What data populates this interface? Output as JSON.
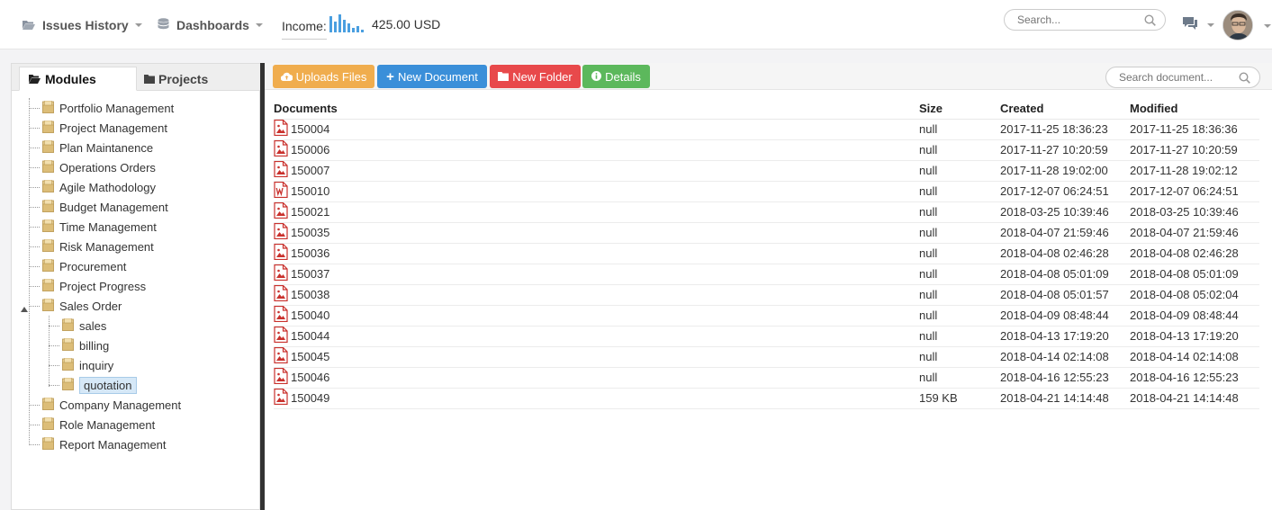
{
  "header": {
    "issues_history": "Issues History",
    "dashboards": "Dashboards",
    "income_label": "Income:",
    "income_value": "425.00 USD",
    "search_placeholder": "Search..."
  },
  "left_panel": {
    "tabs": [
      {
        "label": "Modules",
        "active": true
      },
      {
        "label": "Projects",
        "active": false
      }
    ],
    "tree": [
      {
        "label": "Portfolio Management",
        "level": 0
      },
      {
        "label": "Project Management",
        "level": 0
      },
      {
        "label": "Plan Maintanence",
        "level": 0
      },
      {
        "label": "Operations Orders",
        "level": 0
      },
      {
        "label": "Agile Mathodology",
        "level": 0
      },
      {
        "label": "Budget Management",
        "level": 0
      },
      {
        "label": "Time Management",
        "level": 0
      },
      {
        "label": "Risk Management",
        "level": 0
      },
      {
        "label": "Procurement",
        "level": 0
      },
      {
        "label": "Project Progress",
        "level": 0
      },
      {
        "label": "Sales Order",
        "level": 0,
        "expanded": true
      },
      {
        "label": "sales",
        "level": 1
      },
      {
        "label": "billing",
        "level": 1
      },
      {
        "label": "inquiry",
        "level": 1
      },
      {
        "label": "quotation",
        "level": 1,
        "selected": true
      },
      {
        "label": "Company Management",
        "level": 0
      },
      {
        "label": "Role Management",
        "level": 0
      },
      {
        "label": "Report Management",
        "level": 0
      }
    ]
  },
  "toolbar": {
    "upload": "Uploads Files",
    "new_document": "New Document",
    "new_folder": "New Folder",
    "details": "Details",
    "search_placeholder": "Search document..."
  },
  "colors": {
    "upload": "#f0ad4e",
    "new_document": "#3a8fd9",
    "new_folder": "#e8494b",
    "details": "#5cb85c",
    "file_icon": "#c9302c"
  },
  "table": {
    "headers": [
      "Documents",
      "Size",
      "Created",
      "Modified"
    ],
    "rows": [
      {
        "name": "150004",
        "type": "image",
        "size": "null",
        "created": "2017-11-25 18:36:23",
        "modified": "2017-11-25 18:36:36"
      },
      {
        "name": "150006",
        "type": "image",
        "size": "null",
        "created": "2017-11-27 10:20:59",
        "modified": "2017-11-27 10:20:59"
      },
      {
        "name": "150007",
        "type": "image",
        "size": "null",
        "created": "2017-11-28 19:02:00",
        "modified": "2017-11-28 19:02:12"
      },
      {
        "name": "150010",
        "type": "word",
        "size": "null",
        "created": "2017-12-07 06:24:51",
        "modified": "2017-12-07 06:24:51"
      },
      {
        "name": "150021",
        "type": "image",
        "size": "null",
        "created": "2018-03-25 10:39:46",
        "modified": "2018-03-25 10:39:46"
      },
      {
        "name": "150035",
        "type": "image",
        "size": "null",
        "created": "2018-04-07 21:59:46",
        "modified": "2018-04-07 21:59:46"
      },
      {
        "name": "150036",
        "type": "image",
        "size": "null",
        "created": "2018-04-08 02:46:28",
        "modified": "2018-04-08 02:46:28"
      },
      {
        "name": "150037",
        "type": "image",
        "size": "null",
        "created": "2018-04-08 05:01:09",
        "modified": "2018-04-08 05:01:09"
      },
      {
        "name": "150038",
        "type": "image",
        "size": "null",
        "created": "2018-04-08 05:01:57",
        "modified": "2018-04-08 05:02:04"
      },
      {
        "name": "150040",
        "type": "image",
        "size": "null",
        "created": "2018-04-09 08:48:44",
        "modified": "2018-04-09 08:48:44"
      },
      {
        "name": "150044",
        "type": "image",
        "size": "null",
        "created": "2018-04-13 17:19:20",
        "modified": "2018-04-13 17:19:20"
      },
      {
        "name": "150045",
        "type": "image",
        "size": "null",
        "created": "2018-04-14 02:14:08",
        "modified": "2018-04-14 02:14:08"
      },
      {
        "name": "150046",
        "type": "image",
        "size": "null",
        "created": "2018-04-16 12:55:23",
        "modified": "2018-04-16 12:55:23"
      },
      {
        "name": "150049",
        "type": "image",
        "size": "159 KB",
        "created": "2018-04-21 14:14:48",
        "modified": "2018-04-21 14:14:48"
      }
    ]
  },
  "icons": {
    "issues_history": "folder-open-icon",
    "dashboards": "database-icon",
    "income_chart": "bar-sparkline-icon",
    "search": "search-icon",
    "chat": "comments-icon",
    "upload": "cloud-upload-icon",
    "new_document": "plus-icon",
    "new_folder": "folder-icon",
    "details": "info-circle-icon",
    "file_image": "file-image-icon",
    "file_word": "file-word-icon"
  }
}
